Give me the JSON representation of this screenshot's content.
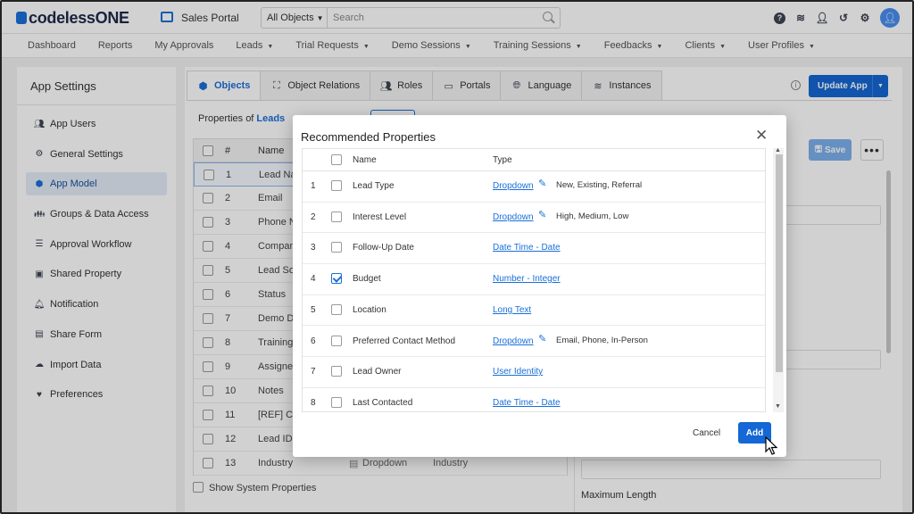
{
  "header": {
    "logo_text": "codelessONE",
    "app_name": "Sales Portal",
    "search_scope": "All Objects",
    "search_placeholder": "Search"
  },
  "nav": {
    "items": [
      {
        "label": "Dashboard",
        "dropdown": false
      },
      {
        "label": "Reports",
        "dropdown": false
      },
      {
        "label": "My Approvals",
        "dropdown": false
      },
      {
        "label": "Leads",
        "dropdown": true
      },
      {
        "label": "Trial Requests",
        "dropdown": true
      },
      {
        "label": "Demo Sessions",
        "dropdown": true
      },
      {
        "label": "Training Sessions",
        "dropdown": true
      },
      {
        "label": "Feedbacks",
        "dropdown": true
      },
      {
        "label": "Clients",
        "dropdown": true
      },
      {
        "label": "User Profiles",
        "dropdown": true
      }
    ]
  },
  "sidebar": {
    "title": "App Settings",
    "items": [
      {
        "label": "App Users",
        "icon": "users-icon",
        "active": false
      },
      {
        "label": "General Settings",
        "icon": "gear-icon",
        "active": false
      },
      {
        "label": "App Model",
        "icon": "cube-icon",
        "active": true
      },
      {
        "label": "Groups & Data Access",
        "icon": "group-icon",
        "active": false
      },
      {
        "label": "Approval Workflow",
        "icon": "checklist-icon",
        "active": false
      },
      {
        "label": "Shared Property",
        "icon": "shared-icon",
        "active": false
      },
      {
        "label": "Notification",
        "icon": "bell-icon",
        "active": false
      },
      {
        "label": "Share Form",
        "icon": "form-icon",
        "active": false
      },
      {
        "label": "Import Data",
        "icon": "cloud-upload-icon",
        "active": false
      },
      {
        "label": "Preferences",
        "icon": "hand-heart-icon",
        "active": false
      }
    ]
  },
  "tabs": [
    {
      "label": "Objects",
      "active": true
    },
    {
      "label": "Object Relations",
      "active": false
    },
    {
      "label": "Roles",
      "active": false
    },
    {
      "label": "Portals",
      "active": false
    },
    {
      "label": "Language",
      "active": false
    },
    {
      "label": "Instances",
      "active": false
    }
  ],
  "main": {
    "update_button": "Update App",
    "properties_of_label": "Properties of",
    "properties_of_object": "Leads",
    "save_button": "Save",
    "show_system_properties": "Show System Properties",
    "maximum_length_label": "Maximum Length",
    "table_headers": {
      "num": "#",
      "name": "Name"
    },
    "rows": [
      {
        "num": "1",
        "name": "Lead Na",
        "selected": true
      },
      {
        "num": "2",
        "name": "Email"
      },
      {
        "num": "3",
        "name": "Phone N"
      },
      {
        "num": "4",
        "name": "Compan"
      },
      {
        "num": "5",
        "name": "Lead Sou"
      },
      {
        "num": "6",
        "name": "Status"
      },
      {
        "num": "7",
        "name": "Demo Da"
      },
      {
        "num": "8",
        "name": "Training"
      },
      {
        "num": "9",
        "name": "Assigne"
      },
      {
        "num": "10",
        "name": "Notes"
      },
      {
        "num": "11",
        "name": "[REF] Cli"
      },
      {
        "num": "12",
        "name": "Lead ID"
      },
      {
        "num": "13",
        "name": "Industry",
        "type": "Dropdown",
        "extra": "Industry"
      }
    ]
  },
  "modal": {
    "title": "Recommended Properties",
    "headers": {
      "name": "Name",
      "type": "Type"
    },
    "rows": [
      {
        "num": "1",
        "name": "Lead Type",
        "type": "Dropdown",
        "options": "New, Existing, Referral",
        "checked": false
      },
      {
        "num": "2",
        "name": "Interest Level",
        "type": "Dropdown",
        "options": "High, Medium, Low",
        "checked": false
      },
      {
        "num": "3",
        "name": "Follow-Up Date",
        "type": "Date Time - Date",
        "options": "",
        "checked": false
      },
      {
        "num": "4",
        "name": "Budget",
        "type": "Number - Integer",
        "options": "",
        "checked": true
      },
      {
        "num": "5",
        "name": "Location",
        "type": "Long Text",
        "options": "",
        "checked": false
      },
      {
        "num": "6",
        "name": "Preferred Contact Method",
        "type": "Dropdown",
        "options": "Email, Phone, In-Person",
        "checked": false
      },
      {
        "num": "7",
        "name": "Lead Owner",
        "type": "User Identity",
        "options": "",
        "checked": false
      },
      {
        "num": "8",
        "name": "Last Contacted",
        "type": "Date Time - Date",
        "options": "",
        "checked": false
      }
    ],
    "cancel_button": "Cancel",
    "add_button": "Add"
  },
  "colors": {
    "accent": "#1467d4",
    "active_sidebar_bg": "#e3ecf8"
  }
}
